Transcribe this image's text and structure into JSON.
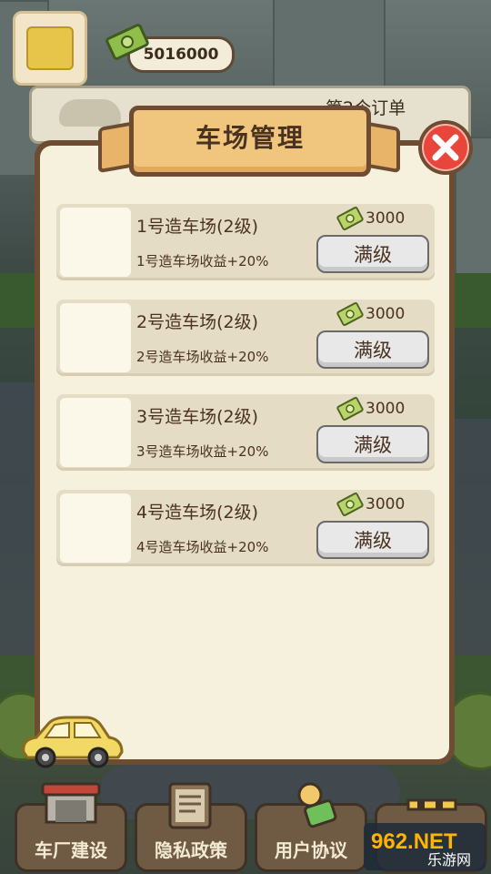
{
  "hud": {
    "money": "5016000",
    "order_text": "第2个订单"
  },
  "modal": {
    "title": "车场管理",
    "items": [
      {
        "name": "1号造车场(2级)",
        "desc": "1号造车场收益+20%",
        "cost": "3000",
        "button": "满级"
      },
      {
        "name": "2号造车场(2级)",
        "desc": "2号造车场收益+20%",
        "cost": "3000",
        "button": "满级"
      },
      {
        "name": "3号造车场(2级)",
        "desc": "3号造车场收益+20%",
        "cost": "3000",
        "button": "满级"
      },
      {
        "name": "4号造车场(2级)",
        "desc": "4号造车场收益+20%",
        "cost": "3000",
        "button": "满级"
      }
    ]
  },
  "nav": {
    "factory": "车厂建设",
    "privacy": "隐私政策",
    "agreement": "用户协议"
  },
  "watermark": {
    "logo": "962.NET",
    "caption": "乐游网"
  },
  "colors": {
    "panel_border": "#6d4c31",
    "panel_bg": "#f5f1dd",
    "close_red": "#e8453b",
    "title_plate": "#f0c57d"
  },
  "icons": {
    "currency": "cash-bundle-icon",
    "close": "close-x-icon"
  }
}
